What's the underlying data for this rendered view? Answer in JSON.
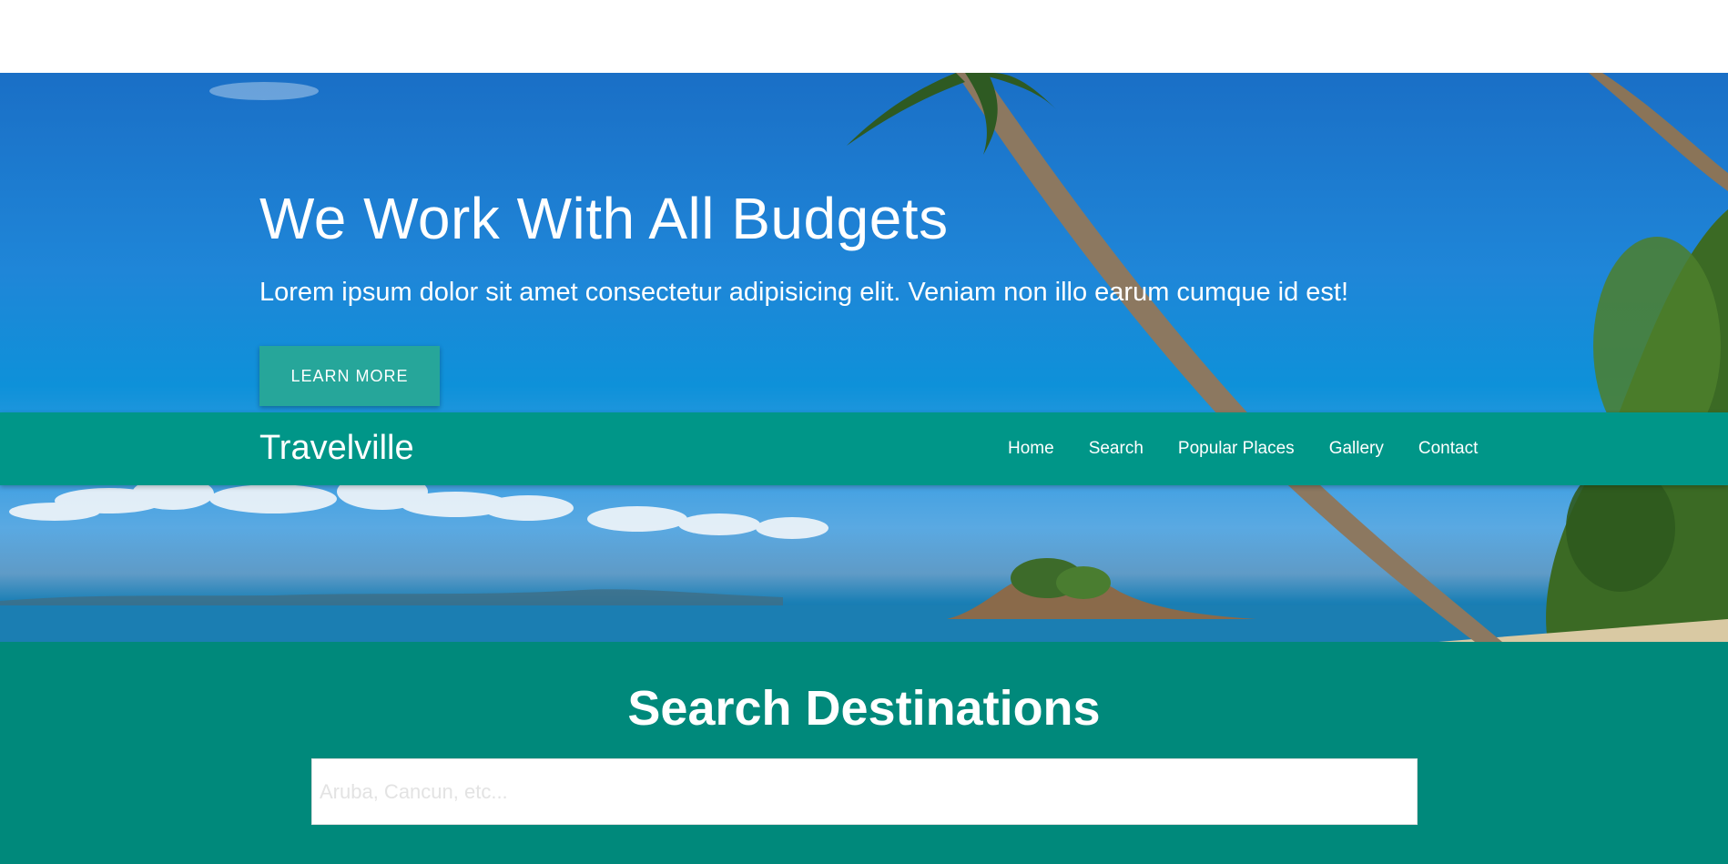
{
  "hero": {
    "title": "We Work With All Budgets",
    "subtitle": "Lorem ipsum dolor sit amet consectetur adipisicing elit. Veniam non illo earum cumque id est!",
    "button_label": "LEARN MORE"
  },
  "navbar": {
    "brand": "Travelville",
    "links": [
      {
        "label": "Home"
      },
      {
        "label": "Search"
      },
      {
        "label": "Popular Places"
      },
      {
        "label": "Gallery"
      },
      {
        "label": "Contact"
      }
    ]
  },
  "search": {
    "title": "Search Destinations",
    "placeholder": "Aruba, Cancun, etc...",
    "value": ""
  },
  "colors": {
    "navbar": "#009688",
    "button": "#26a69a",
    "search_section": "#00897b"
  }
}
